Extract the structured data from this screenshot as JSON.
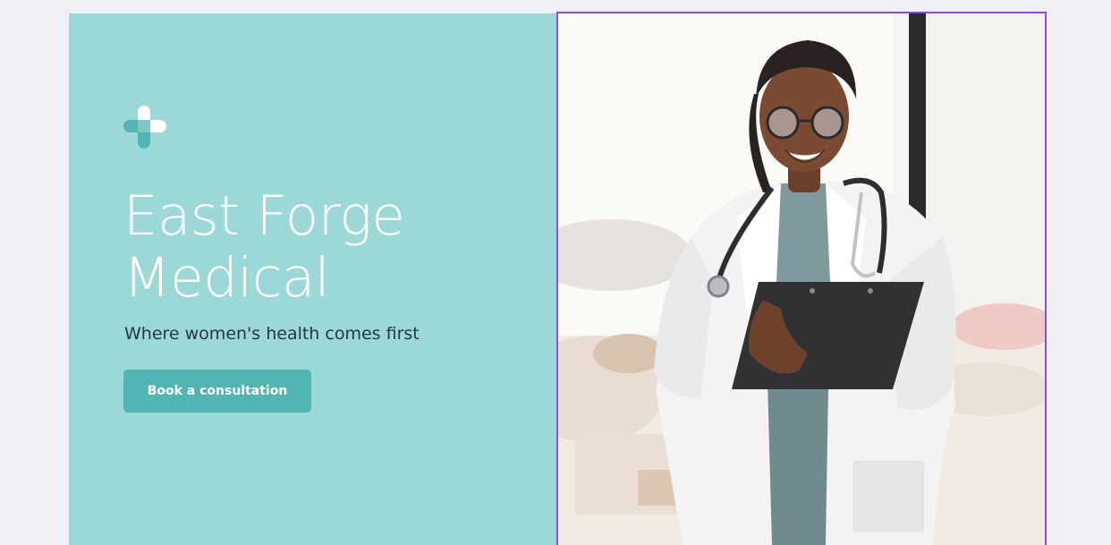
{
  "brand": {
    "logo_icon": "medical-cross-icon",
    "title_lines": [
      "East Forge",
      "Medical"
    ],
    "tagline": "Where women's health comes first"
  },
  "cta": {
    "label": "Book a consultation"
  },
  "hero_image": {
    "description_icon": "doctor-photo"
  },
  "colors": {
    "panel": "#9dd8d8",
    "button": "#52b5b4",
    "tagline": "#24383d",
    "selection": "#8a4be6"
  }
}
